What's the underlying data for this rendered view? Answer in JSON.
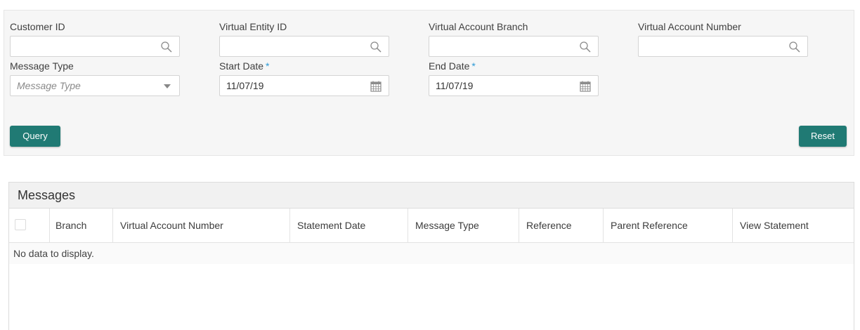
{
  "search": {
    "customer_id": {
      "label": "Customer ID",
      "value": ""
    },
    "virtual_entity_id": {
      "label": "Virtual Entity ID",
      "value": ""
    },
    "virtual_account_branch": {
      "label": "Virtual Account Branch",
      "value": ""
    },
    "virtual_account_number": {
      "label": "Virtual Account Number",
      "value": ""
    },
    "message_type": {
      "label": "Message Type",
      "placeholder": "Message Type"
    },
    "start_date": {
      "label": "Start Date",
      "required_mark": "*",
      "value": "11/07/19"
    },
    "end_date": {
      "label": "End Date",
      "required_mark": "*",
      "value": "11/07/19"
    },
    "query_label": "Query",
    "reset_label": "Reset"
  },
  "messages": {
    "title": "Messages",
    "columns": [
      "Branch",
      "Virtual Account Number",
      "Statement Date",
      "Message Type",
      "Reference",
      "Parent Reference",
      "View Statement"
    ],
    "empty_text": "No data to display."
  },
  "colors": {
    "accent": "#207a74",
    "required": "#2d9ad6"
  }
}
